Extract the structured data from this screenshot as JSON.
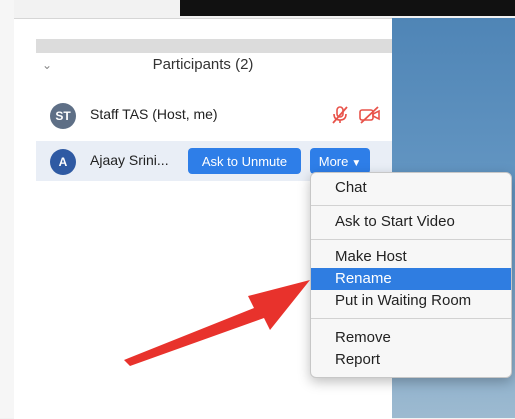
{
  "participants": {
    "title": "Participants (2)",
    "list": [
      {
        "initials": "ST",
        "name": "Staff TAS (Host, me)",
        "avatar_color": "#5e6f86"
      },
      {
        "initials": "A",
        "name": "Ajaay Srini...",
        "avatar_color": "#2f5aa3"
      }
    ]
  },
  "actions": {
    "unmute_label": "Ask to Unmute",
    "more_label": "More"
  },
  "menu": {
    "items": [
      "Chat",
      "Ask to Start Video",
      "Make Host",
      "Rename",
      "Put in Waiting Room",
      "Remove",
      "Report"
    ],
    "highlighted": "Rename"
  },
  "colors": {
    "accent": "#2e7ee8",
    "highlight": "#2f7de1",
    "muted_icon": "#e8534a",
    "arrow": "#e8322c"
  }
}
